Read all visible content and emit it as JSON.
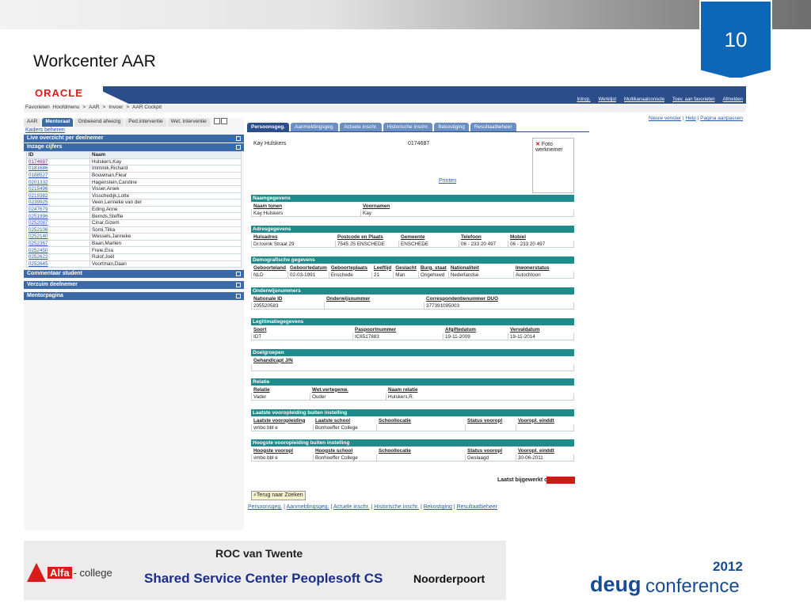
{
  "slide": {
    "number": "10",
    "title": "Workcenter AAR"
  },
  "oracle": {
    "logo": "ORACLE",
    "toplinks": [
      "Introp.",
      "Werklijst",
      "Multikanaalconsole",
      "Toev. aan favorieten",
      "Afmelden"
    ],
    "breadcrumb": [
      "Favorieten",
      "Hoofdmenu",
      ">",
      "AAR",
      ">",
      "Invoer",
      ">",
      "AAR Cockpit"
    ]
  },
  "left": {
    "tabs": [
      "AAR",
      "Mentoraat",
      "Onbekend afwezig",
      "Ped.interventie",
      "Wet. interventie"
    ],
    "kaders": "Kaders beheren",
    "sections": {
      "live": "Live overzicht per deelnemer",
      "inzage": "Inzage cijfers",
      "commentaar": "Commentaar student",
      "verzuim": "Verzuim deelnemer",
      "mentor": "Mentorpagina"
    },
    "table_header": [
      "ID",
      "Naam"
    ],
    "rows": [
      [
        "0174687",
        "Hulskers,Kay"
      ],
      [
        "0181686",
        "Imminik,Richard"
      ],
      [
        "0188527",
        "Bouwman,Fleur"
      ],
      [
        "0201332",
        "Hagenstein,Caroline"
      ],
      [
        "0215496",
        "Visser,Aniek"
      ],
      [
        "0219382",
        "Visschedijk,Lotte"
      ],
      [
        "0239925",
        "Veen,Lenneke van der"
      ],
      [
        "0247679",
        "Eding,Anne"
      ],
      [
        "0251996",
        "Bernds,Steffie"
      ],
      [
        "0252087",
        "Cinar,Gizem"
      ],
      [
        "0252106",
        "Somi,Tilka"
      ],
      [
        "0252140",
        "Wessels,Janneke"
      ],
      [
        "0252367",
        "Baan,Marlien"
      ],
      [
        "0252450",
        "Freie,Eva"
      ],
      [
        "0252622",
        "Rulof,Joël"
      ],
      [
        "0252645",
        "Voortman,Daan"
      ]
    ]
  },
  "right": {
    "links": [
      "Nieuw venster",
      "Help",
      "Pagina aanpassen"
    ],
    "tabs": [
      "Persoonsgeg.",
      "Aanmeldingsgeg.",
      "Actuele inschr.",
      "Historische inschr.",
      "Bekostiging",
      "Resultaatbeheer"
    ],
    "student_name": "Kay Hulskers",
    "student_id": "0174687",
    "photo": "Foto werknemer",
    "printen": "Printen",
    "naam": {
      "head": "Naamgegevens",
      "cols": [
        "Naam tonen",
        "Voornamen"
      ],
      "vals": [
        "Kay Hulskers",
        "Kay"
      ]
    },
    "adres": {
      "head": "Adresgegevens",
      "cols": [
        "Huisadres",
        "Postcode en Plaats",
        "Gemeente",
        "Telefoon",
        "Mobiel"
      ],
      "vals": [
        "Dr.lovink Straat 29",
        "7545 JS ENSCHEDE",
        "ENSCHEDE",
        "06 - 233 20 497",
        "06 - 233 20 497"
      ]
    },
    "demo": {
      "head": "Demografische gegevens",
      "cols": [
        "Geboorteland",
        "Geboortedatum",
        "Geboorteplaats",
        "Leeftijd",
        "Geslacht",
        "Burg. staat",
        "Nationaliteit",
        "Inwonerstatus"
      ],
      "vals": [
        "NLD",
        "02-03-1991",
        "Enschede",
        "21",
        "Man",
        "Ongehuwd",
        "Nederlandse",
        "Autochtoon"
      ]
    },
    "onderwijs": {
      "head": "Onderwijsnummers",
      "cols": [
        "Nationale ID",
        "Onderwijsnummer",
        "Correspondentienummer DUO"
      ],
      "vals": [
        "205520583",
        "",
        "377391095003"
      ]
    },
    "legit": {
      "head": "Legitimatiegegevens",
      "cols": [
        "Soort",
        "Paspoortnummer",
        "Afgiftedatum",
        "Vervaldatum"
      ],
      "vals": [
        "IDT",
        "IC6517883",
        "19-11-2009",
        "19-11-2014"
      ]
    },
    "doel": {
      "head": "Doelgroepen",
      "cols": [
        "Gehandicapt J/N"
      ]
    },
    "relatie": {
      "head": "Relatie",
      "cols": [
        "Relatie",
        "Wet.vertegenw.",
        "Naam relatie"
      ],
      "vals": [
        "Vader",
        "Ouder",
        "Hulskers,R."
      ]
    },
    "laatste": {
      "head": "Laatste vooropleiding buiten instelling",
      "cols": [
        "Laatste vooropleiding",
        "Laatste school",
        "Schoollocatie",
        "Status vooropl",
        "Vooropl. einddt"
      ],
      "vals": [
        "vmbo bbl e",
        "Bonhoeffer College",
        "",
        "",
        ""
      ]
    },
    "hoogste": {
      "head": "Hoogste vooropleiding buiten instelling",
      "cols": [
        "Hoogste vooropl",
        "Hoogste school",
        "Schoollocatie",
        "Status vooropl",
        "Vooropl. einddt"
      ],
      "vals": [
        "vmbo bbl e",
        "Bonhoeffer College",
        "",
        "Geslaagd",
        "30-06-2011"
      ]
    },
    "bijgewerkt": "Laatst bijgewerkt op",
    "terug": "Terug naar Zoeken",
    "bottom_links": [
      "Persoonsgeg.",
      "Aanmeldingsgeg.",
      "Actuele inschr.",
      "Historische inschr.",
      "Bekostiging",
      "Resultaatbeheer"
    ]
  },
  "footer": {
    "alfa": "Alfa",
    "college": "- college",
    "roc": "ROC van Twente",
    "ssc": "Shared Service Center Peoplesoft CS",
    "noorderpoort": "Noorderpoort",
    "deug": "deug",
    "conference": "conference",
    "year": "2012"
  },
  "colors": {
    "accent": "#0d66b8",
    "oracle_blue": "#2b4d8a",
    "teal": "#1f8b8b",
    "red": "#d01818"
  }
}
